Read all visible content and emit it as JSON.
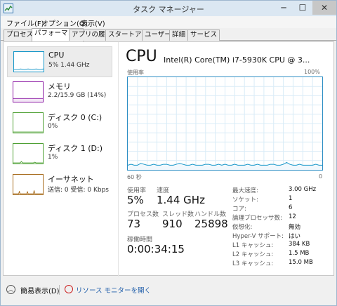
{
  "window": {
    "title": "タスク マネージャー",
    "min_glyph": "─",
    "max_glyph": "☐",
    "close_glyph": "✕",
    "icon": "task-manager-icon"
  },
  "menu": [
    "ファイル(F)",
    "オプション(O)",
    "表示(V)"
  ],
  "tabs": [
    "プロセス",
    "パフォーマンス",
    "アプリの履歴",
    "スタートアップ",
    "ユーザー",
    "詳細",
    "サービス"
  ],
  "active_tab": "パフォーマンス",
  "sidebar": [
    {
      "name": "CPU",
      "sub": "5% 1.44 GHz",
      "color": "#1797c9"
    },
    {
      "name": "メモリ",
      "sub": "2.2/15.9 GB (14%)",
      "color": "#8b19a3"
    },
    {
      "name": "ディスク 0 (C:)",
      "sub": "0%",
      "color": "#4da033"
    },
    {
      "name": "ディスク 1 (D:)",
      "sub": "1%",
      "color": "#4da033"
    },
    {
      "name": "イーサネット",
      "sub": "送信: 0 受信: 0 Kbps",
      "color": "#a76c1e"
    }
  ],
  "main": {
    "title": "CPU",
    "model": "Intel(R) Core(TM) i7-5930K CPU @ 3...",
    "graph_label_left": "使用率",
    "graph_label_right": "100%",
    "graph_time_left": "60 秒",
    "graph_time_right": "0",
    "usage_label": "使用率",
    "usage_value": "5%",
    "speed_label": "速度",
    "speed_value": "1.44 GHz",
    "process_label": "プロセス数",
    "process_value": "73",
    "thread_label": "スレッド数",
    "thread_value": "910",
    "handle_label": "ハンドル数",
    "handle_value": "25898",
    "uptime_label": "稼働時間",
    "uptime_value": "0:00:34:15"
  },
  "specs": [
    {
      "label": "最大速度:",
      "value": "3.00 GHz"
    },
    {
      "label": "ソケット:",
      "value": "1"
    },
    {
      "label": "コア:",
      "value": "6"
    },
    {
      "label": "論理プロセッサ数:",
      "value": "12"
    },
    {
      "label": "仮想化:",
      "value": "無効"
    },
    {
      "label": "Hyper-V サポート:",
      "value": "はい"
    },
    {
      "label": "L1 キャッシュ:",
      "value": "384 KB"
    },
    {
      "label": "L2 キャッシュ:",
      "value": "1.5 MB"
    },
    {
      "label": "L3 キャッシュ:",
      "value": "15.0 MB"
    }
  ],
  "footer": {
    "fewer_details": "簡易表示(D)",
    "fewer_icon": "chevron-up-icon",
    "resource_monitor": "リソース モニターを開く",
    "resource_icon": "resource-monitor-icon"
  },
  "colors": {
    "cpu_graph_line": "#1797c9",
    "cpu_graph_fill": "#f1f8fd",
    "graph_grid": "#d9ecf7"
  },
  "cpu_history_percent": [
    5,
    6,
    5,
    5,
    7,
    6,
    5,
    5,
    6,
    5,
    5,
    6,
    6,
    5,
    5,
    6,
    7,
    6,
    5,
    5,
    6,
    5,
    5,
    5,
    6,
    6,
    5,
    5,
    6,
    5,
    6,
    5,
    5,
    6,
    5,
    5,
    5,
    6,
    5,
    5,
    6,
    5,
    5,
    5,
    6,
    6,
    5,
    5,
    6,
    8,
    6,
    5,
    5,
    6,
    5,
    5,
    5,
    5,
    6,
    5,
    5
  ]
}
